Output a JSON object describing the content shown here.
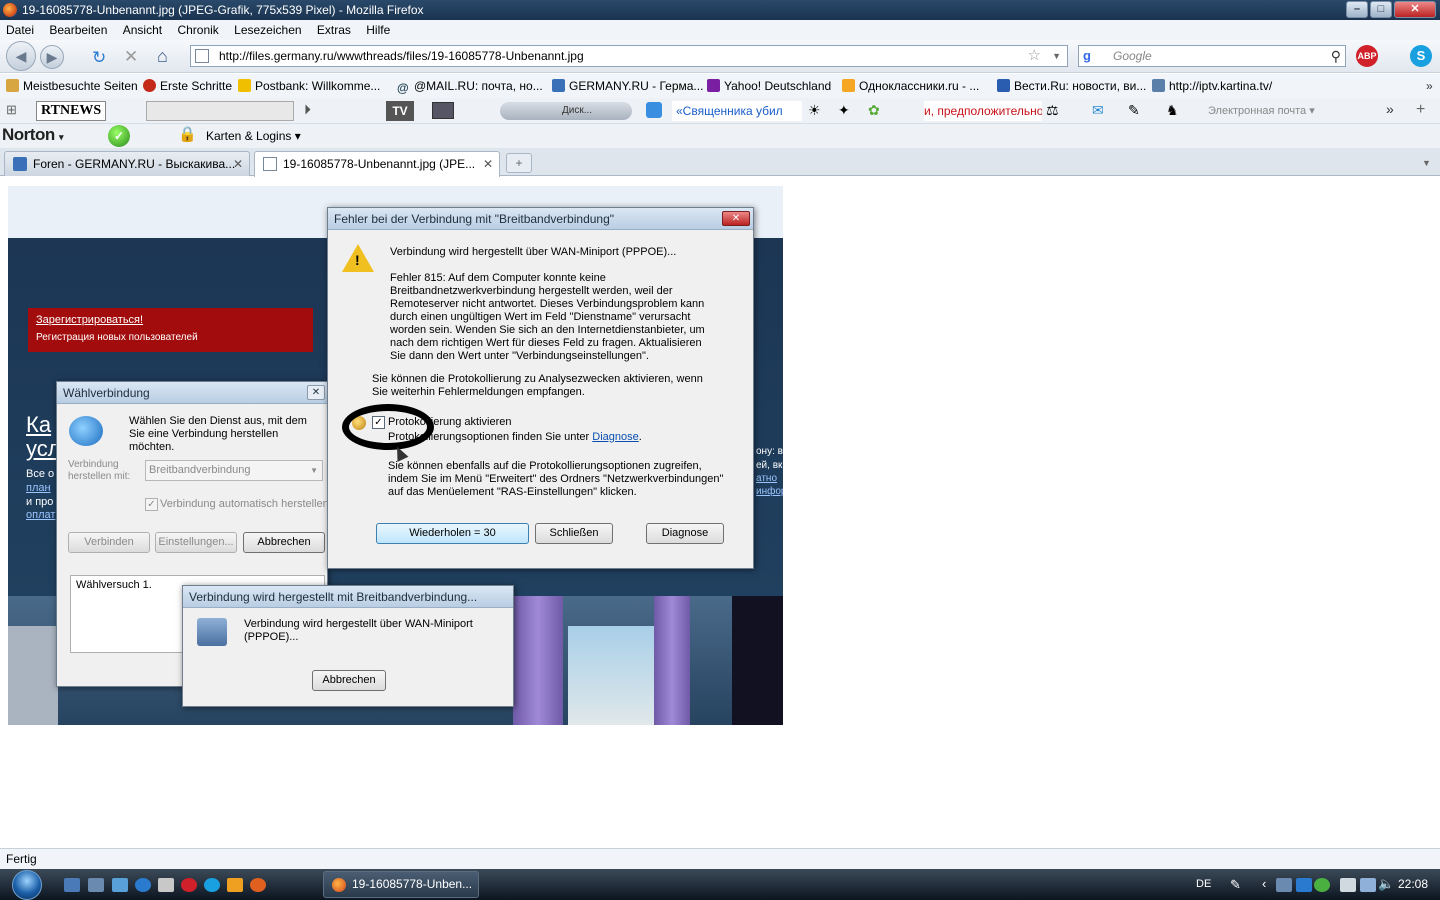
{
  "window": {
    "title": "19-16085778-Unbenannt.jpg (JPEG-Grafik, 775x539 Pixel) - Mozilla Firefox"
  },
  "menu": [
    "Datei",
    "Bearbeiten",
    "Ansicht",
    "Chronik",
    "Lesezeichen",
    "Extras",
    "Hilfe"
  ],
  "nav": {
    "url": "http://files.germany.ru/wwwthreads/files/19-16085778-Unbenannt.jpg",
    "search_placeholder": "Google"
  },
  "bookmarks": [
    "Meistbesuchte Seiten",
    "Erste Schritte",
    "Postbank: Willkomme...",
    "@MAIL.RU: почта, но...",
    "GERMANY.RU - Герма...",
    "Yahoo! Deutschland",
    "Одноклассники.ru - ...",
    "Вести.Ru: новости, ви...",
    "http://iptv.kartina.tv/"
  ],
  "toolbar2": {
    "rtnews": "RTNEWS",
    "disk": "Диск...",
    "news_ticker": "«Священника убил",
    "red_ticker": "и, предположительно",
    "email": "Электронная почта"
  },
  "toolbar3": {
    "norton": "Norton",
    "logins": "Karten & Logins"
  },
  "tabs": [
    {
      "label": "Foren - GERMANY.RU - Выскакива..."
    },
    {
      "label": "19-16085778-Unbenannt.jpg (JPE..."
    }
  ],
  "image": {
    "reg_link": "Зарегистрироваться!",
    "reg_sub": "Регистрация новых пользователей",
    "big1": "Ка",
    "big2": "усл",
    "side_lines": [
      "Все о",
      "план",
      "и про",
      "оплат"
    ],
    "right_lines": [
      "ону: в",
      "ей, вк",
      "атно",
      "инфор"
    ]
  },
  "dialup": {
    "title": "Wählverbindung",
    "prompt": "Wählen Sie den Dienst aus, mit dem Sie eine Verbindung herstellen möchten.",
    "label": "Verbindung herstellen mit:",
    "select": "Breitbandverbindung",
    "auto": "Verbindung automatisch herstellen",
    "btn_connect": "Verbinden",
    "btn_settings": "Einstellungen...",
    "btn_cancel": "Abbrechen",
    "log": "Wählversuch 1."
  },
  "connecting": {
    "title": "Verbindung wird hergestellt mit Breitbandverbindung...",
    "text": "Verbindung wird hergestellt über WAN-Miniport (PPPOE)...",
    "btn_cancel": "Abbrechen"
  },
  "error": {
    "title": "Fehler bei der Verbindung mit \"Breitbandverbindung\"",
    "line1": "Verbindung wird hergestellt über WAN-Miniport (PPPOE)...",
    "message": "Fehler 815: Auf dem Computer konnte keine Breitbandnetzwerkverbindung hergestellt werden, weil der Remoteserver nicht antwortet. Dieses Verbindungsproblem kann durch einen ungültigen Wert im Feld \"Dienstname\" verursacht worden sein. Wenden Sie sich an den Internetdienstanbieter, um nach dem richtigen Wert für dieses Feld zu fragen. Aktualisieren Sie dann den Wert unter \"Verbindungseinstellungen\".",
    "logging_info": "Sie können die Protokollierung zu Analysezwecken aktivieren, wenn Sie weiterhin Fehlermeldungen empfangen.",
    "checkbox": "Protokollierung aktivieren",
    "options_prefix": "Protokollierungsoptionen finden Sie unter",
    "options_link": "Diagnose",
    "options_suffix": ".",
    "more": "Sie können ebenfalls auf die Protokollierungsoptionen zugreifen, indem Sie im Menü \"Erweitert\" des Ordners \"Netzwerkverbindungen\" auf das Menüelement \"RAS-Einstellungen\" klicken.",
    "btn_retry": "Wiederholen = 30",
    "btn_close": "Schließen",
    "btn_diag": "Diagnose"
  },
  "status": "Fertig",
  "taskbar": {
    "window": "19-16085778-Unben...",
    "lang": "DE",
    "time": "22:08"
  }
}
